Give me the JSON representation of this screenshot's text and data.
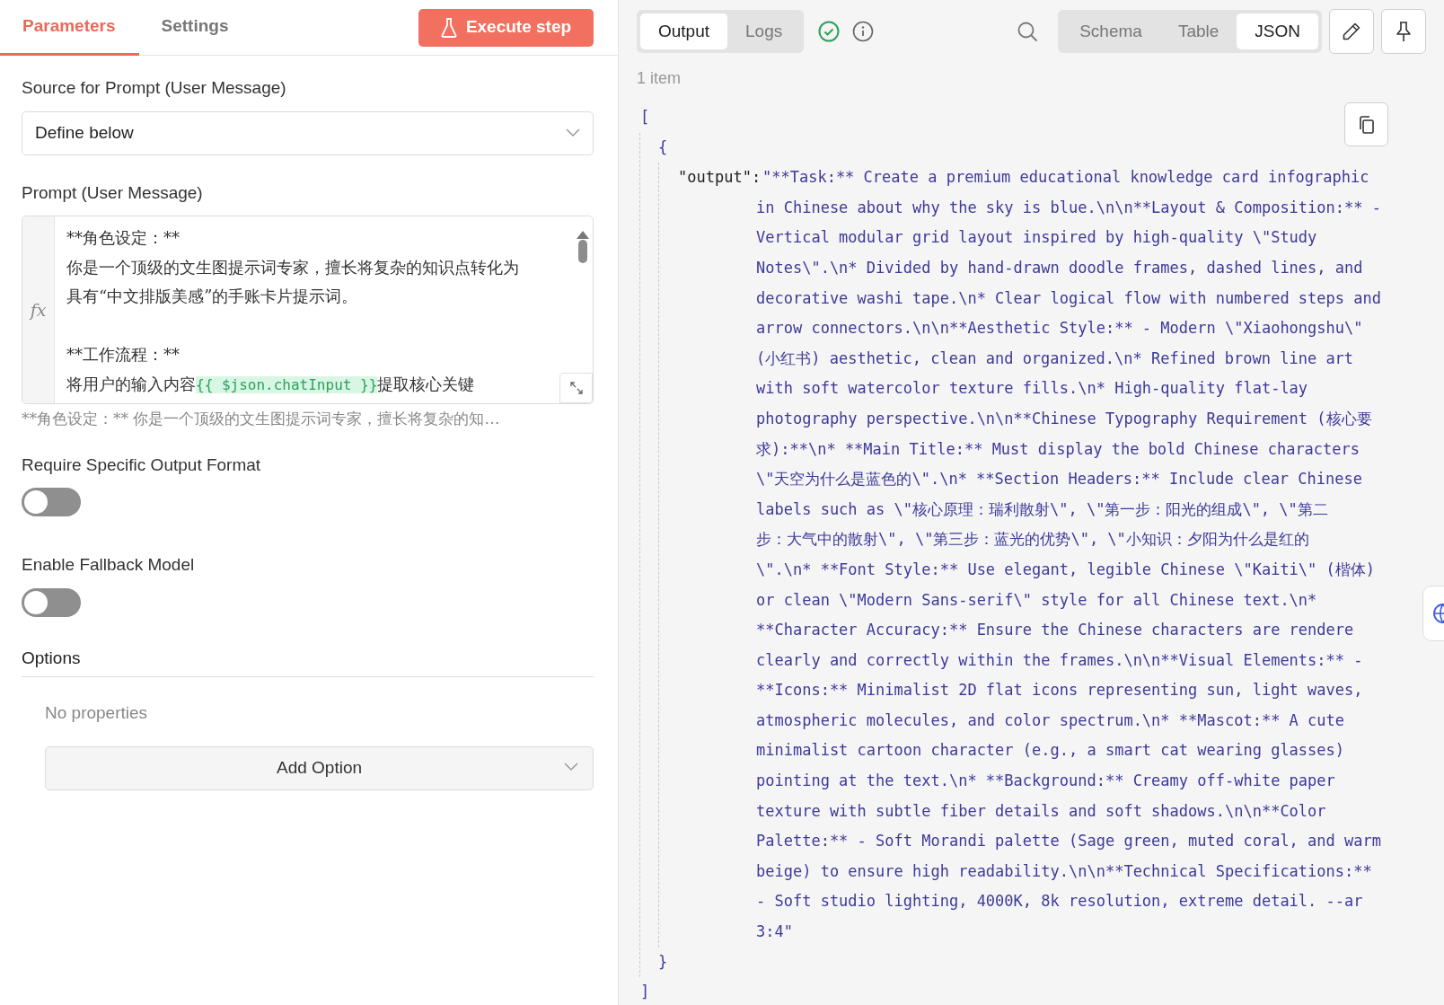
{
  "parameters_panel": {
    "tabs": [
      {
        "label": "Parameters",
        "selected": true
      },
      {
        "label": "Settings",
        "selected": false
      }
    ],
    "execute_button": "Execute step",
    "fields": [
      {
        "kind": "select",
        "label": "Source for Prompt (User Message)",
        "value": "Define below"
      },
      {
        "kind": "editor",
        "label": "Prompt (User Message)",
        "gutter_label": "fx",
        "lines": [
          {
            "segments": [
              {
                "kind": "plain",
                "text": "**角色设定：**"
              }
            ]
          },
          {
            "segments": [
              {
                "kind": "plain",
                "text": "你是一个顶级的文生图提示词专家，擅长将复杂的知识点转化为"
              }
            ]
          },
          {
            "segments": [
              {
                "kind": "plain",
                "text": "具有“中文排版美感”的手账卡片提示词。"
              }
            ]
          },
          {
            "segments": [
              {
                "kind": "blank"
              }
            ]
          },
          {
            "segments": [
              {
                "kind": "plain",
                "text": "**工作流程：**"
              }
            ]
          },
          {
            "segments": [
              {
                "kind": "plain",
                "text": "将用户的输入内容"
              },
              {
                "kind": "expression",
                "text": "{{ $json.chatInput }}"
              },
              {
                "kind": "plain",
                "text": "提取核心关键"
              }
            ]
          }
        ],
        "hint": "**角色设定：** 你是一个顶级的文生图提示词专家，擅长将复杂的知…"
      },
      {
        "kind": "toggle",
        "label": "Require Specific Output Format",
        "on": false
      },
      {
        "kind": "toggle",
        "label": "Enable Fallback Model",
        "on": false
      }
    ],
    "options": {
      "title": "Options",
      "empty_text": "No properties",
      "add_button": "Add Option"
    }
  },
  "output_panel": {
    "tabs": [
      {
        "label": "Output",
        "selected": true
      },
      {
        "label": "Logs",
        "selected": false
      }
    ],
    "view_tabs": [
      {
        "label": "Schema",
        "selected": false
      },
      {
        "label": "Table",
        "selected": false
      },
      {
        "label": "JSON",
        "selected": true
      }
    ],
    "item_count": "1 item",
    "json": {
      "open_bracket": "[",
      "open_brace": "{",
      "key": "\"output\":",
      "value_lines": [
        "\"**Task:** Create a premium educational knowledge card infographic",
        "in Chinese about why the sky is blue.\\n\\n**Layout & Composition:** -",
        "Vertical modular grid layout inspired by high-quality \\\"Study",
        "Notes\\\".\\n* Divided by hand-drawn doodle frames, dashed lines, and",
        "decorative washi tape.\\n* Clear logical flow with numbered steps and",
        "arrow connectors.\\n\\n**Aesthetic Style:** - Modern \\\"Xiaohongshu\\\"",
        "(小红书) aesthetic, clean and organized.\\n* Refined brown line art",
        "with soft watercolor texture fills.\\n* High-quality flat-lay",
        "photography perspective.\\n\\n**Chinese Typography Requirement (核心要",
        "求):**\\n* **Main Title:** Must display the bold Chinese characters",
        "\\\"天空为什么是蓝色的\\\".\\n* **Section Headers:** Include clear Chinese",
        "labels such as \\\"核心原理：瑞利散射\\\", \\\"第一步：阳光的组成\\\", \\\"第二",
        "步：大气中的散射\\\", \\\"第三步：蓝光的优势\\\", \\\"小知识：夕阳为什么是红的",
        "\\\".\\n* **Font Style:** Use elegant, legible Chinese \\\"Kaiti\\\" (楷体)",
        "or clean \\\"Modern Sans-serif\\\" style for all Chinese text.\\n*",
        "**Character Accuracy:** Ensure the Chinese characters are rendere",
        "clearly and correctly within the frames.\\n\\n**Visual Elements:** -",
        "**Icons:** Minimalist 2D flat icons representing sun, light waves,",
        "atmospheric molecules, and color spectrum.\\n* **Mascot:** A cute",
        "minimalist cartoon character (e.g., a smart cat wearing glasses)",
        "pointing at the text.\\n* **Background:** Creamy off-white paper",
        "texture with subtle fiber details and soft shadows.\\n\\n**Color",
        "Palette:** - Soft Morandi palette (Sage green, muted coral, and warm",
        "beige) to ensure high readability.\\n\\n**Technical Specifications:**",
        "- Soft studio lighting, 4000K, 8k resolution, extreme detail. --ar",
        "3:4\""
      ],
      "close_brace": "}",
      "close_bracket": "]"
    }
  }
}
